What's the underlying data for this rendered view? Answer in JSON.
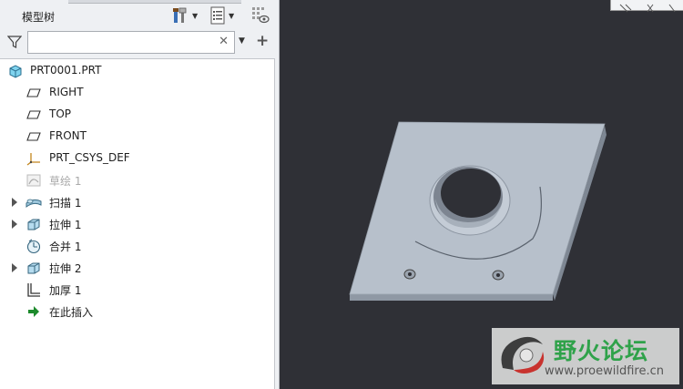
{
  "panel": {
    "title": "模型树",
    "search": {
      "value": "",
      "placeholder": ""
    }
  },
  "tree": {
    "items": [
      {
        "label": "PRT0001.PRT",
        "icon": "part-icon",
        "expandable": false,
        "dim": false
      },
      {
        "label": "RIGHT",
        "icon": "datum-plane-icon",
        "expandable": false,
        "dim": false
      },
      {
        "label": "TOP",
        "icon": "datum-plane-icon",
        "expandable": false,
        "dim": false
      },
      {
        "label": "FRONT",
        "icon": "datum-plane-icon",
        "expandable": false,
        "dim": false
      },
      {
        "label": "PRT_CSYS_DEF",
        "icon": "csys-icon",
        "expandable": false,
        "dim": false
      },
      {
        "label": "草绘 1",
        "icon": "sketch-icon",
        "expandable": false,
        "dim": true
      },
      {
        "label": "扫描 1",
        "icon": "sweep-icon",
        "expandable": true,
        "dim": false
      },
      {
        "label": "拉伸 1",
        "icon": "extrude-icon",
        "expandable": true,
        "dim": false
      },
      {
        "label": "合并 1",
        "icon": "merge-icon",
        "expandable": false,
        "dim": false
      },
      {
        "label": "拉伸 2",
        "icon": "extrude-icon",
        "expandable": true,
        "dim": false
      },
      {
        "label": "加厚 1",
        "icon": "thicken-icon",
        "expandable": false,
        "dim": false
      },
      {
        "label": "在此插入",
        "icon": "insert-here-arrow-icon",
        "expandable": false,
        "dim": false
      }
    ]
  },
  "watermark": {
    "title": "野火论坛",
    "url": "www.proewildfire.cn"
  },
  "colors": {
    "viewport_bg": "#2f3036",
    "model_face": "#b7c0cb",
    "insert_arrow": "#1d8a2c"
  }
}
